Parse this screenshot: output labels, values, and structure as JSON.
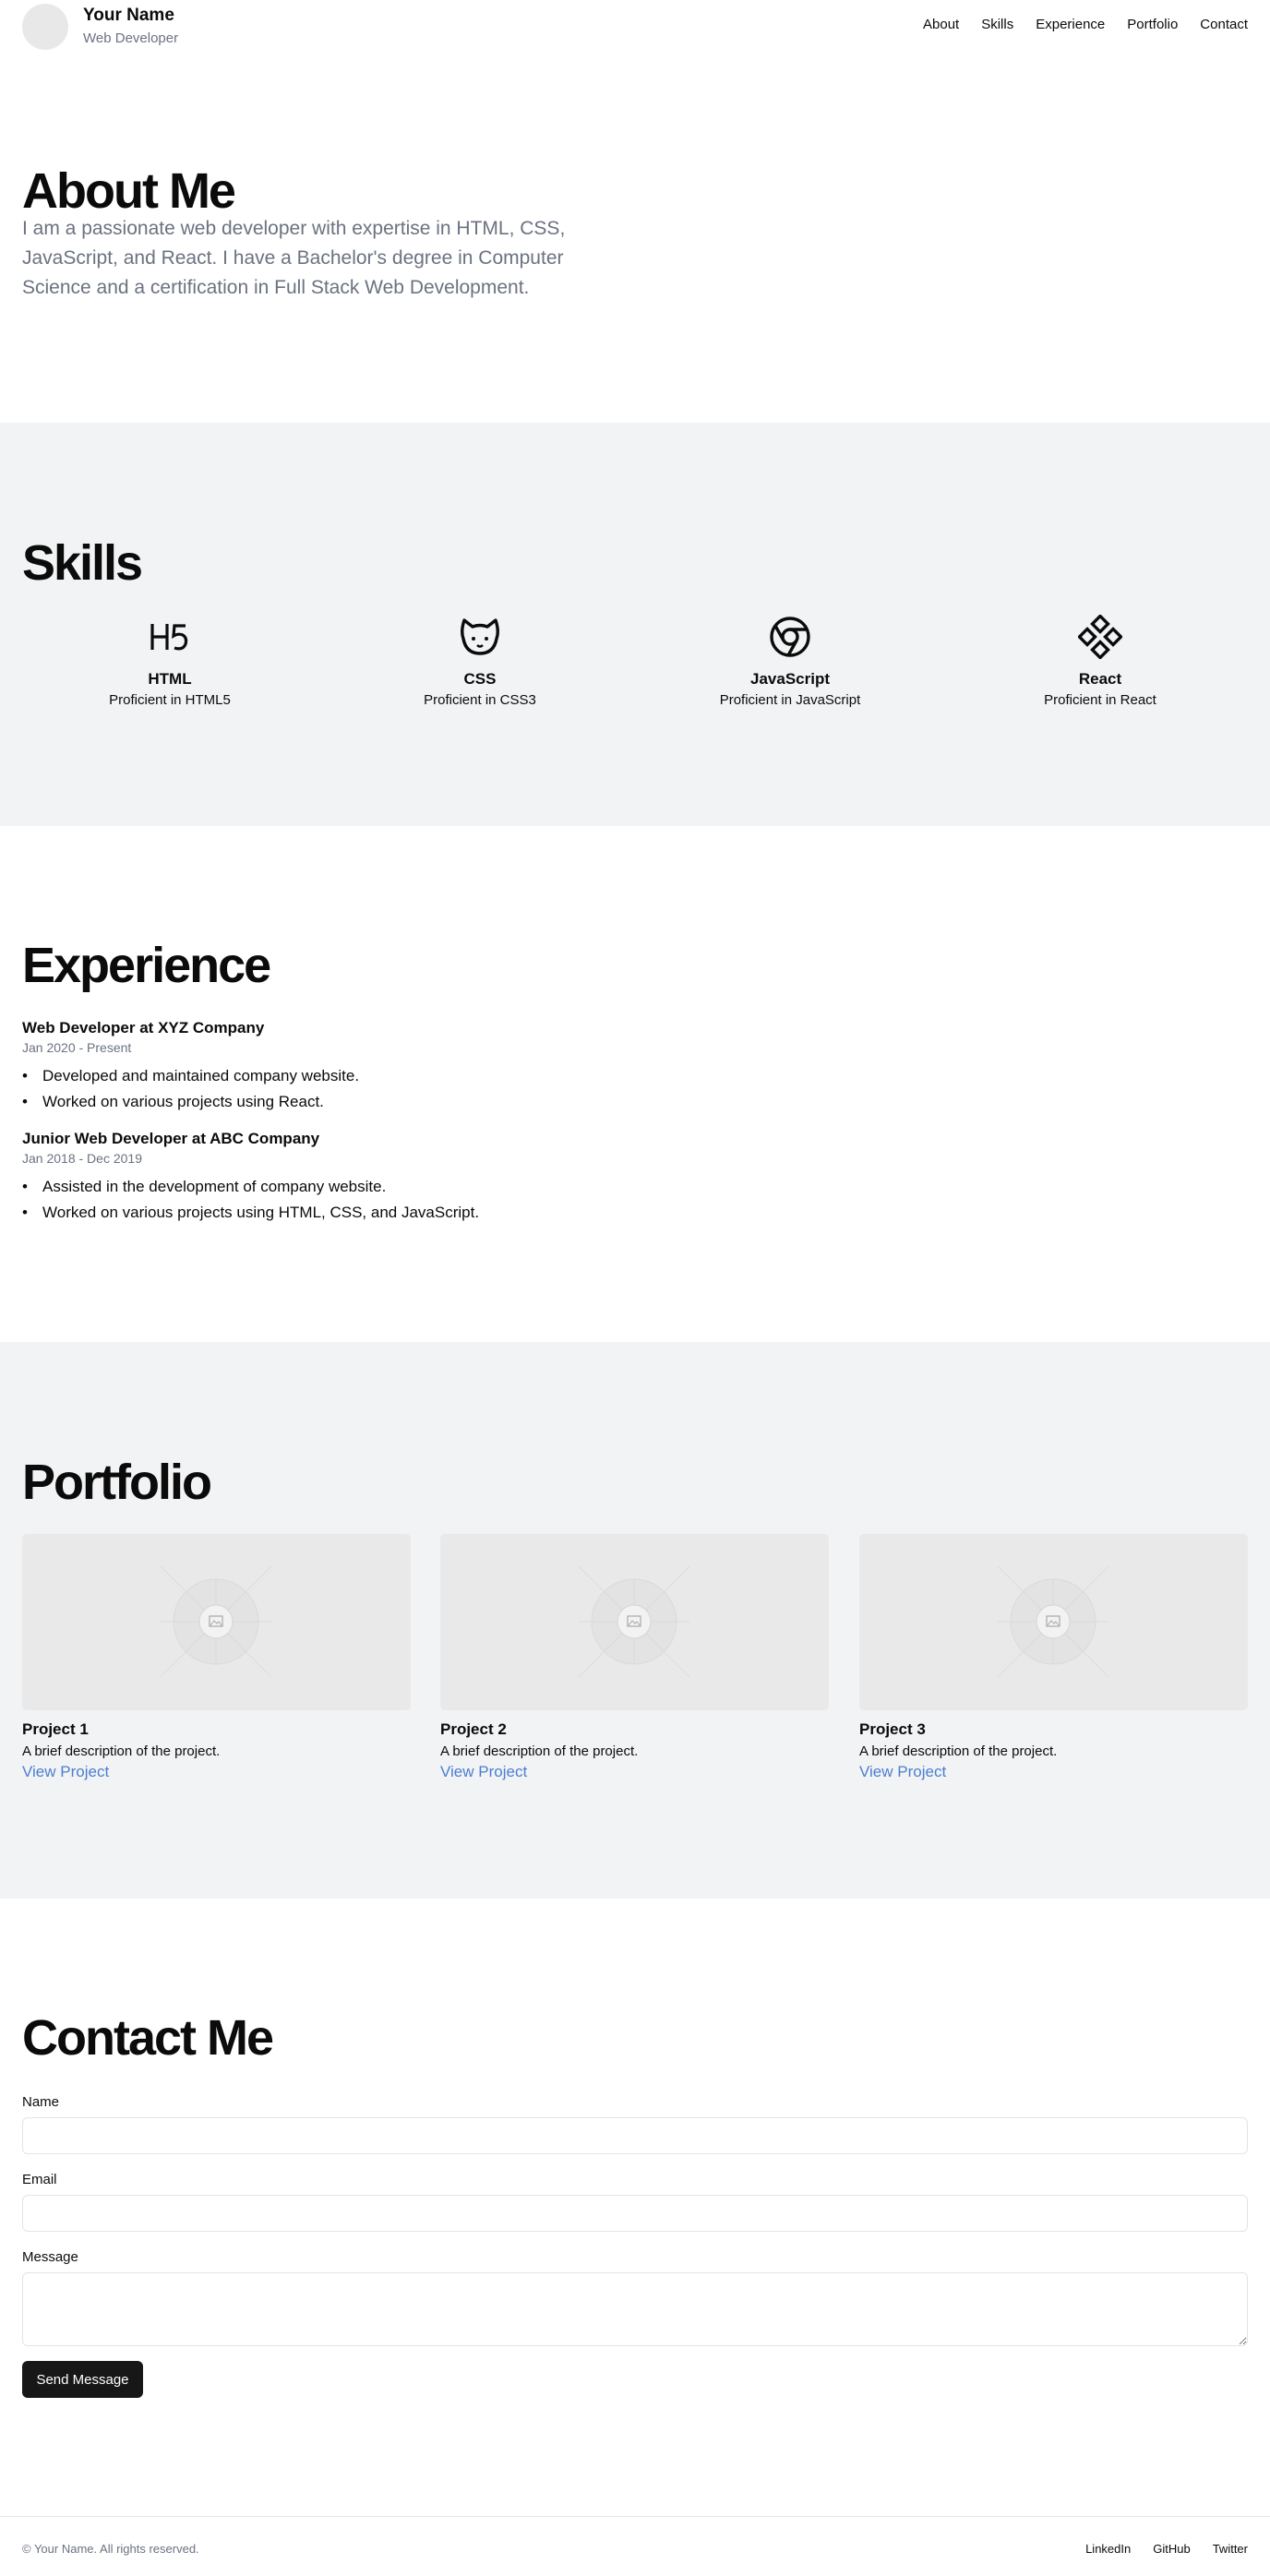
{
  "header": {
    "name": "Your Name",
    "role": "Web Developer",
    "nav": [
      "About",
      "Skills",
      "Experience",
      "Portfolio",
      "Contact"
    ]
  },
  "about": {
    "title": "About Me",
    "text": "I am a passionate web developer with expertise in HTML, CSS, JavaScript, and React. I have a Bachelor's degree in Computer Science and a certification in Full Stack Web Development."
  },
  "skills": {
    "title": "Skills",
    "items": [
      {
        "name": "HTML",
        "desc": "Proficient in HTML5",
        "icon": "html5-icon"
      },
      {
        "name": "CSS",
        "desc": "Proficient in CSS3",
        "icon": "cat-icon"
      },
      {
        "name": "JavaScript",
        "desc": "Proficient in JavaScript",
        "icon": "chrome-icon"
      },
      {
        "name": "React",
        "desc": "Proficient in React",
        "icon": "component-icon"
      }
    ]
  },
  "experience": {
    "title": "Experience",
    "jobs": [
      {
        "title": "Web Developer at XYZ Company",
        "dates": "Jan 2020 - Present",
        "bullets": [
          "Developed and maintained company website.",
          "Worked on various projects using React."
        ]
      },
      {
        "title": "Junior Web Developer at ABC Company",
        "dates": "Jan 2018 - Dec 2019",
        "bullets": [
          "Assisted in the development of company website.",
          "Worked on various projects using HTML, CSS, and JavaScript."
        ]
      }
    ]
  },
  "portfolio": {
    "title": "Portfolio",
    "projects": [
      {
        "title": "Project 1",
        "desc": "A brief description of the project.",
        "link": "View Project"
      },
      {
        "title": "Project 2",
        "desc": "A brief description of the project.",
        "link": "View Project"
      },
      {
        "title": "Project 3",
        "desc": "A brief description of the project.",
        "link": "View Project"
      }
    ]
  },
  "contact": {
    "title": "Contact Me",
    "name_label": "Name",
    "email_label": "Email",
    "message_label": "Message",
    "name_value": "",
    "email_value": "",
    "message_value": "",
    "send_label": "Send Message"
  },
  "footer": {
    "copyright": "© Your Name. All rights reserved.",
    "links": [
      "LinkedIn",
      "GitHub",
      "Twitter"
    ]
  },
  "colors": {
    "accent": "#171717",
    "link": "#4a7fd0",
    "muted": "#6b7280",
    "section_gray": "#f2f3f4"
  }
}
